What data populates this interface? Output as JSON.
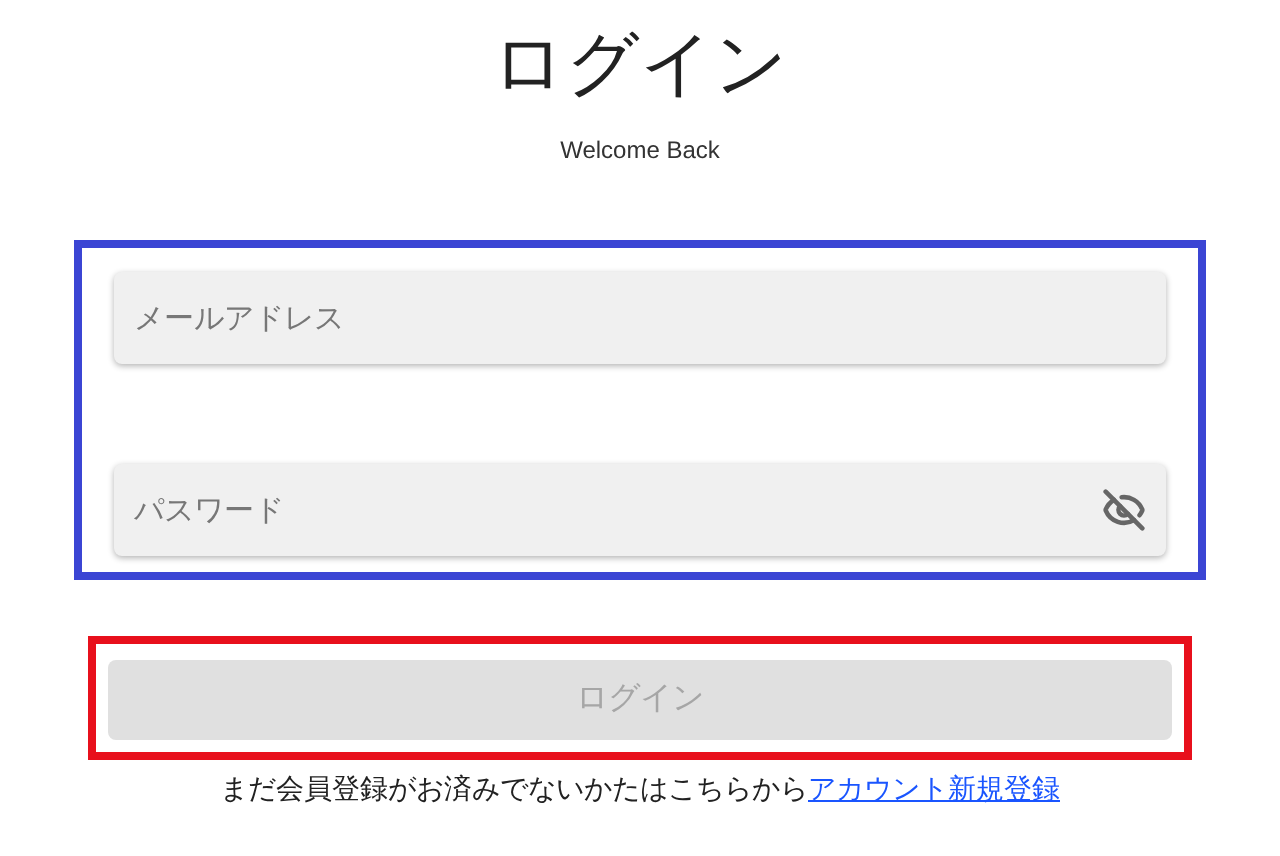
{
  "title": "ログイン",
  "subtitle": "Welcome Back",
  "fields": [
    {
      "kind": "email",
      "placeholder": "メールアドレス"
    },
    {
      "kind": "password",
      "placeholder": "パスワード",
      "visible": false
    }
  ],
  "login_button": {
    "label": "ログイン",
    "disabled": true
  },
  "signup": {
    "text": "まだ会員登録がお済みでないかたはこちらから",
    "link": "アカウント新規登録"
  }
}
